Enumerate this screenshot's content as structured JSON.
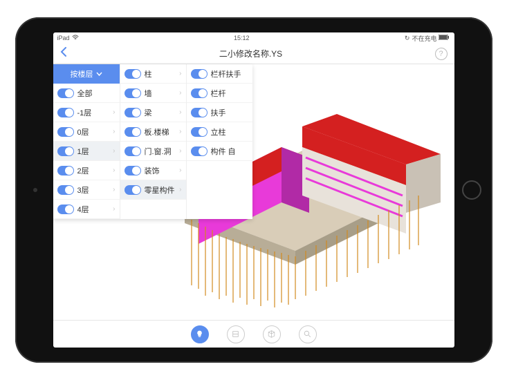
{
  "status": {
    "device": "iPad",
    "time": "15:12",
    "battery_text": "不在充电"
  },
  "navbar": {
    "title": "二小修改名称.YS"
  },
  "panel": {
    "header": "按楼层",
    "col1": [
      {
        "label": "全部",
        "chevron": false,
        "selected": false
      },
      {
        "label": "-1层",
        "chevron": true,
        "selected": false
      },
      {
        "label": "0层",
        "chevron": true,
        "selected": false
      },
      {
        "label": "1层",
        "chevron": true,
        "selected": true
      },
      {
        "label": "2层",
        "chevron": true,
        "selected": false
      },
      {
        "label": "3层",
        "chevron": true,
        "selected": false
      },
      {
        "label": "4层",
        "chevron": true,
        "selected": false
      }
    ],
    "col2": [
      {
        "label": "柱",
        "chevron": true,
        "selected": false
      },
      {
        "label": "墙",
        "chevron": true,
        "selected": false
      },
      {
        "label": "梁",
        "chevron": true,
        "selected": false
      },
      {
        "label": "板.楼梯",
        "chevron": true,
        "selected": false
      },
      {
        "label": "门.窗.洞",
        "chevron": true,
        "selected": false
      },
      {
        "label": "装饰",
        "chevron": true,
        "selected": false
      },
      {
        "label": "零星构件",
        "chevron": true,
        "selected": true
      }
    ],
    "col3": [
      {
        "label": "栏杆扶手",
        "chevron": false
      },
      {
        "label": "栏杆",
        "chevron": false
      },
      {
        "label": "扶手",
        "chevron": false
      },
      {
        "label": "立柱",
        "chevron": false
      },
      {
        "label": "构件  自",
        "chevron": false
      }
    ]
  },
  "toolbar": {
    "tools": [
      {
        "name": "bulb",
        "active": true
      },
      {
        "name": "box",
        "active": false
      },
      {
        "name": "cube",
        "active": false
      },
      {
        "name": "search",
        "active": false
      }
    ]
  }
}
